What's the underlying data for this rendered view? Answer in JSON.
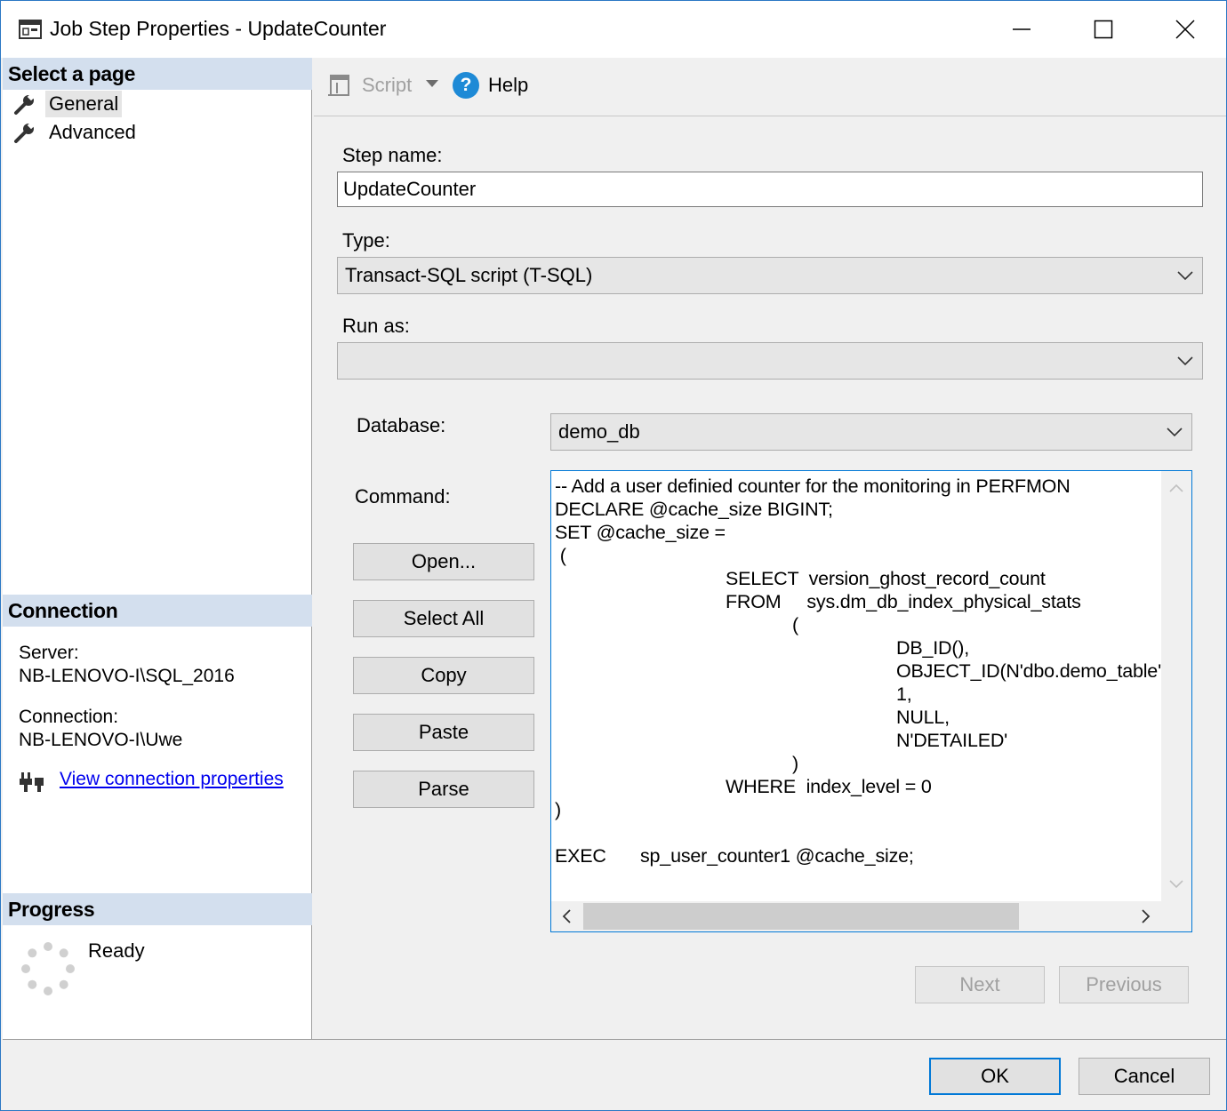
{
  "window": {
    "title": "Job Step Properties - UpdateCounter"
  },
  "left": {
    "select_page_header": "Select a page",
    "pages": [
      {
        "label": "General",
        "selected": true
      },
      {
        "label": "Advanced",
        "selected": false
      }
    ],
    "connection_header": "Connection",
    "server_label": "Server:",
    "server_value": "NB-LENOVO-I\\SQL_2016",
    "connection_label": "Connection:",
    "connection_value": "NB-LENOVO-I\\Uwe",
    "view_connection_link": "View connection properties",
    "progress_header": "Progress",
    "progress_status": "Ready"
  },
  "toolbar": {
    "script_label": "Script",
    "help_label": "Help"
  },
  "form": {
    "step_name_label": "Step name:",
    "step_name_value": "UpdateCounter",
    "type_label": "Type:",
    "type_value": "Transact-SQL script (T-SQL)",
    "run_as_label": "Run as:",
    "run_as_value": "",
    "database_label": "Database:",
    "database_value": "demo_db",
    "command_label": "Command:",
    "command_text": "-- Add a user definied counter for the monitoring in PERFMON\nDECLARE @cache_size BIGINT;\nSET @cache_size =\n (\n\t\tSELECT  version_ghost_record_count\n\t\tFROM     sys.dm_db_index_physical_stats\n\t\t             (\n\t\t\t\tDB_ID(),\n\t\t\t\tOBJECT_ID(N'dbo.demo_table', N'U'),\n\t\t\t\t1,\n\t\t\t\tNULL,\n\t\t\t\tN'DETAILED'\n\t\t             )\n\t\tWHERE  index_level = 0\n)\n\nEXEC\tsp_user_counter1 @cache_size;",
    "buttons": {
      "open": "Open...",
      "select_all": "Select All",
      "copy": "Copy",
      "paste": "Paste",
      "parse": "Parse"
    },
    "next_label": "Next",
    "previous_label": "Previous"
  },
  "footer": {
    "ok_label": "OK",
    "cancel_label": "Cancel"
  },
  "colors": {
    "accent": "#0078d7",
    "section_header_bg": "#d3dfee",
    "link": "#0000ee",
    "help_icon": "#1e8ad6"
  }
}
